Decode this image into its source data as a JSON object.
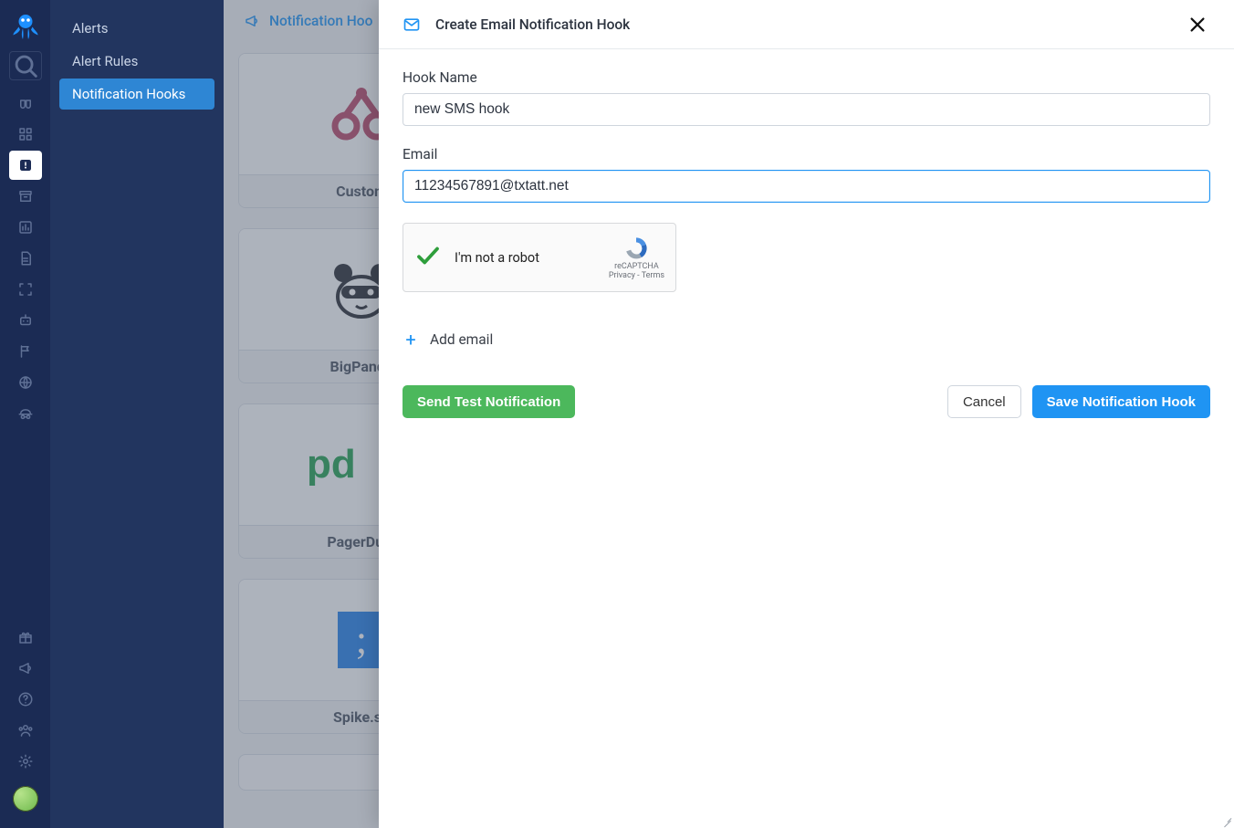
{
  "side_nav": {
    "items": [
      {
        "label": "Alerts"
      },
      {
        "label": "Alert Rules"
      },
      {
        "label": "Notification Hooks",
        "active": true
      }
    ]
  },
  "tab": {
    "label": "Notification Hoo"
  },
  "hook_cards": [
    {
      "label": "Custom"
    },
    {
      "label": "BigPanda"
    },
    {
      "label": "PagerDuty"
    },
    {
      "label": "Spike.sh"
    }
  ],
  "modal": {
    "title": "Create Email Notification Hook",
    "fields": {
      "hook_name": {
        "label": "Hook Name",
        "value": "new SMS hook"
      },
      "email": {
        "label": "Email",
        "value": "11234567891@txtatt.net"
      }
    },
    "recaptcha": {
      "label": "I'm not a robot",
      "brand": "reCAPTCHA",
      "legal": "Privacy - Terms"
    },
    "add_email": "Add email",
    "buttons": {
      "test": "Send Test Notification",
      "cancel": "Cancel",
      "save": "Save Notification Hook"
    }
  },
  "rail_icons": [
    "binoculars-icon",
    "grid-icon",
    "alert-icon",
    "archive-icon",
    "chart-icon",
    "file-icon",
    "focus-icon",
    "robot-icon",
    "flag-icon",
    "globe-icon",
    "incognito-icon"
  ],
  "rail_bottom_icons": [
    "gift-icon",
    "megaphone-icon",
    "help-icon",
    "team-icon",
    "gear-icon"
  ]
}
